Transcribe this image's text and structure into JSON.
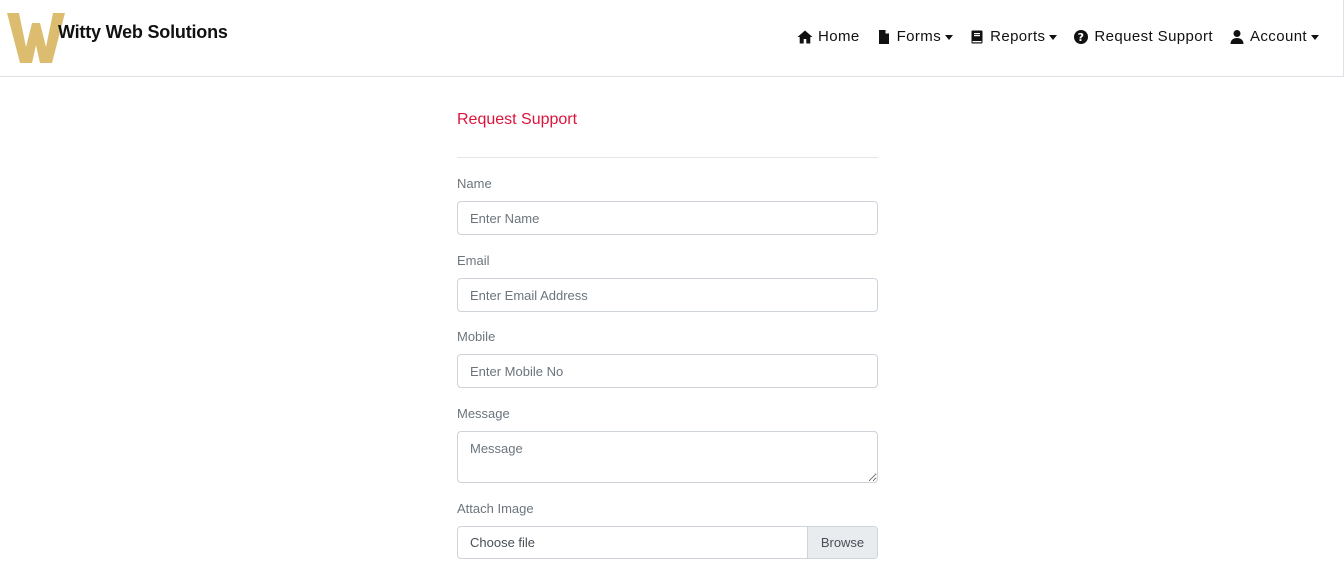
{
  "brand": {
    "name": "Witty Web Solutions",
    "logo_letter": "W",
    "logo_color": "#dcbd6f"
  },
  "nav": {
    "items": [
      {
        "label": "Home",
        "icon": "home-icon",
        "dropdown": false
      },
      {
        "label": "Forms",
        "icon": "file-icon",
        "dropdown": true
      },
      {
        "label": "Reports",
        "icon": "book-icon",
        "dropdown": true
      },
      {
        "label": "Request Support",
        "icon": "question-circle-icon",
        "dropdown": false
      },
      {
        "label": "Account",
        "icon": "user-icon",
        "dropdown": true
      }
    ]
  },
  "form": {
    "title": "Request Support",
    "title_color": "#dc143c",
    "name": {
      "label": "Name",
      "placeholder": "Enter Name"
    },
    "email": {
      "label": "Email",
      "placeholder": "Enter Email Address"
    },
    "mobile": {
      "label": "Mobile",
      "placeholder": "Enter Mobile No"
    },
    "message": {
      "label": "Message",
      "placeholder": "Message"
    },
    "attach": {
      "label": "Attach Image",
      "text": "Choose file",
      "button": "Browse"
    }
  }
}
